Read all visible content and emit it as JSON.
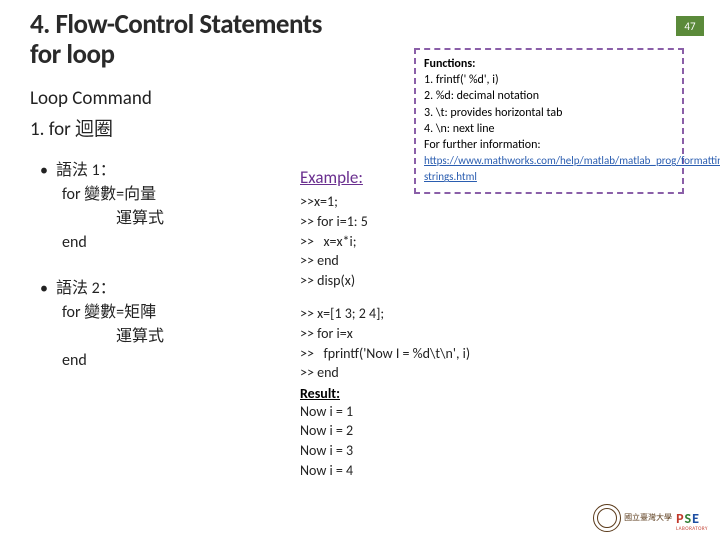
{
  "page_number": "47",
  "title_line1": "4. Flow-Control Statements",
  "title_line2": "for loop",
  "sub1": "Loop Command",
  "sub2": "1.   for 迴圈",
  "syntax1": {
    "head": "語法 1：",
    "l1": "for 變數=向量",
    "l2": "運算式",
    "l3": "end"
  },
  "syntax2": {
    "head": "語法 2：",
    "l1": "for 變數=矩陣",
    "l2": "運算式",
    "l3": "end"
  },
  "example_label": "Example:",
  "code1": ">>x=1;\n>> for i=1: 5\n>>   x=x*i;\n>> end\n>> disp(x)",
  "code2": ">> x=[1 3; 2 4];\n>> for i=x\n>>   fprintf('Now I = %d\\t\\n', i)\n>> end",
  "result_label": "Result:",
  "result_lines": "Now i = 1\nNow i = 2\nNow i = 3\nNow i = 4",
  "info": {
    "title": "Functions:",
    "i1": "1.   frintf(' %d', i)",
    "i2": "2.   %d: decimal notation",
    "i3": "3.   \\t: provides horizontal tab",
    "i4": "4.   \\n: next line",
    "further": "For further information:",
    "link": "https://www.mathworks.com/help/matlab/matlab_prog/formatting-strings.html"
  },
  "footer": {
    "ntu": "國立臺灣大學",
    "pse_p": "P",
    "pse_s": "S",
    "pse_e": "E",
    "lab": "LABORATORY"
  }
}
